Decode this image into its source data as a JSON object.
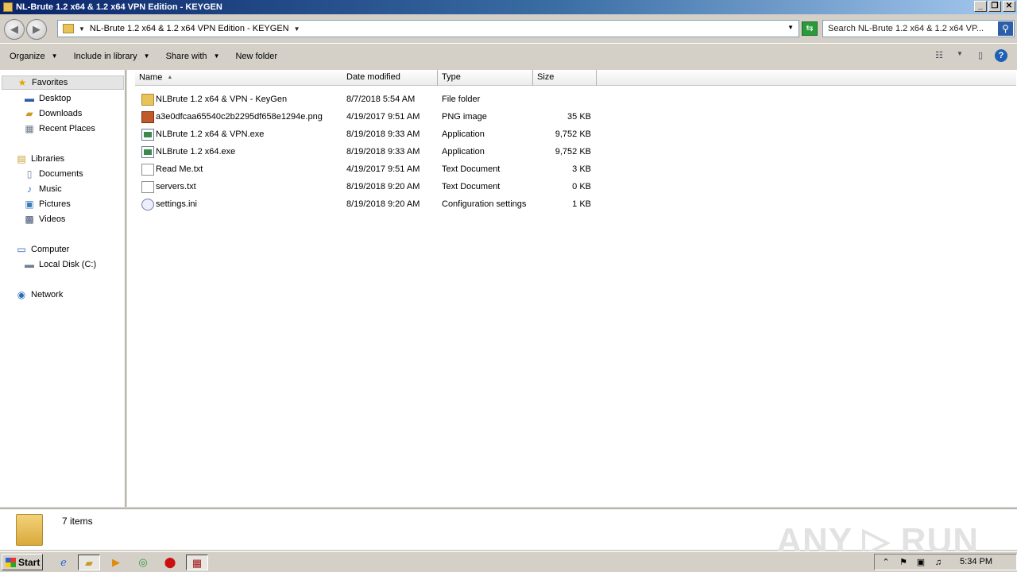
{
  "window": {
    "title": "NL-Brute 1.2 x64 & 1.2 x64 VPN Edition - KEYGEN",
    "controls": [
      "_",
      "❐",
      "✕"
    ]
  },
  "address": {
    "path": "NL-Brute 1.2 x64 & 1.2 x64 VPN Edition - KEYGEN",
    "search_placeholder": "Search NL-Brute 1.2 x64 & 1.2 x64 VP..."
  },
  "toolbar": {
    "organize": "Organize",
    "include_in_library": "Include in library",
    "share_with": "Share with",
    "new_folder": "New folder"
  },
  "nav": {
    "favorites": "Favorites",
    "desktop": "Desktop",
    "downloads": "Downloads",
    "recent_places": "Recent Places",
    "libraries": "Libraries",
    "documents": "Documents",
    "music": "Music",
    "pictures": "Pictures",
    "videos": "Videos",
    "computer": "Computer",
    "local_disk": "Local Disk (C:)",
    "network": "Network"
  },
  "columns": {
    "name": "Name",
    "date_modified": "Date modified",
    "type": "Type",
    "size": "Size"
  },
  "files": [
    {
      "name": "NLBrute 1.2 x64 & VPN - KeyGen",
      "date": "8/7/2018 5:54 AM",
      "type": "File folder",
      "size": "",
      "icon": "folder-icon"
    },
    {
      "name": "a3e0dfcaa65540c2b2295df658e1294e.png",
      "date": "4/19/2017 9:51 AM",
      "type": "PNG image",
      "size": "35 KB",
      "icon": "png-file-icon"
    },
    {
      "name": "NLBrute 1.2 x64 & VPN.exe",
      "date": "8/19/2018 9:33 AM",
      "type": "Application",
      "size": "9,752 KB",
      "icon": "exe-file-icon"
    },
    {
      "name": "NLBrute 1.2 x64.exe",
      "date": "8/19/2018 9:33 AM",
      "type": "Application",
      "size": "9,752 KB",
      "icon": "exe-file-icon"
    },
    {
      "name": "Read Me.txt",
      "date": "4/19/2017 9:51 AM",
      "type": "Text Document",
      "size": "3 KB",
      "icon": "text-file-icon"
    },
    {
      "name": "servers.txt",
      "date": "8/19/2018 9:20 AM",
      "type": "Text Document",
      "size": "0 KB",
      "icon": "text-file-icon"
    },
    {
      "name": "settings.ini",
      "date": "8/19/2018 9:20 AM",
      "type": "Configuration settings",
      "size": "1 KB",
      "icon": "ini-file-icon"
    }
  ],
  "status": {
    "item_count": "7 items",
    "watermark": "ANY ▷ RUN"
  },
  "taskbar": {
    "start": "Start",
    "clock": "5:34 PM"
  }
}
